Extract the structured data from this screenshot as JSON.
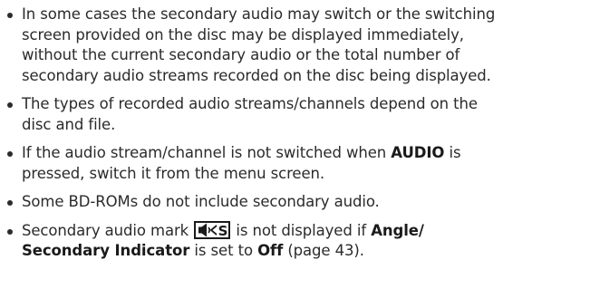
{
  "notes": [
    {
      "lines": [
        "In some cases the secondary audio may switch or the switching",
        "screen provided on the disc may be displayed immediately,",
        "without the current secondary audio or the total number of",
        "secondary audio streams recorded on the disc being displayed."
      ]
    },
    {
      "lines": [
        "The types of recorded audio streams/channels depend on the",
        "disc and file."
      ]
    },
    {
      "line1_before": "If the audio stream/channel is not switched when ",
      "line1_bold": "AUDIO",
      "line1_after": " is",
      "line2": "pressed, switch it from the menu screen."
    },
    {
      "line1": "Some BD-ROMs do not include secondary audio."
    },
    {
      "line1_before": "Secondary audio mark ",
      "icon": "secondary-audio-mark-icon",
      "line1_middle": " is not displayed if ",
      "line1_bold": "Angle/",
      "line2_bold": "Secondary Indicator",
      "line2_middle": " is set to ",
      "line2_bold2": "Off",
      "line2_after": " (page 43)."
    }
  ]
}
